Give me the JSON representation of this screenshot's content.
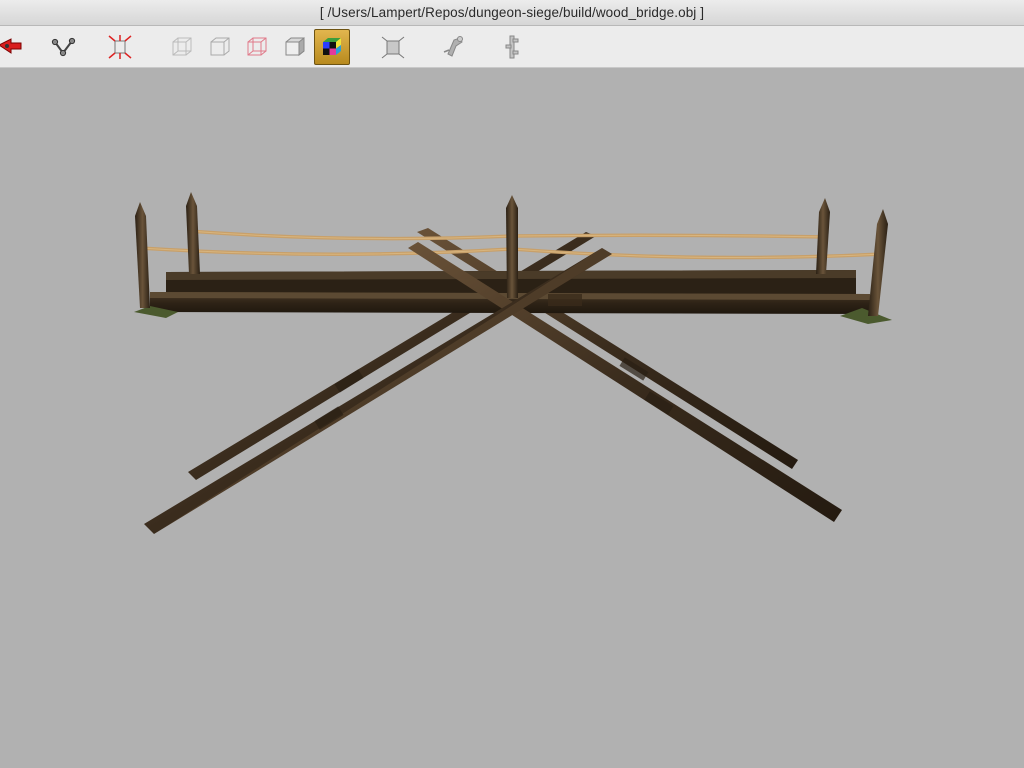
{
  "window": {
    "title": "[ /Users/Lampert/Repos/dungeon-siege/build/wood_bridge.obj ]"
  },
  "toolbar": {
    "tools": [
      {
        "name": "red-arrow-icon",
        "active": false
      },
      {
        "name": "skeleton-bone-icon",
        "active": false
      },
      {
        "name": "normals-icon",
        "active": false
      },
      {
        "name": "wireframe-box-icon",
        "active": false
      },
      {
        "name": "hidden-line-box-icon",
        "active": false
      },
      {
        "name": "red-wireframe-box-icon",
        "active": false
      },
      {
        "name": "solid-box-icon",
        "active": false
      },
      {
        "name": "textured-box-icon",
        "active": true
      },
      {
        "name": "light-box-icon",
        "active": false
      },
      {
        "name": "animation-figure-icon",
        "active": false
      },
      {
        "name": "bone-hierarchy-icon",
        "active": false
      }
    ]
  },
  "colors": {
    "viewport_background": "#b1b1b1",
    "wood_dark": "#3a2c1d",
    "wood_mid": "#5a4630",
    "rope": "#c8a06a",
    "active_tool": "#d4a83c"
  }
}
